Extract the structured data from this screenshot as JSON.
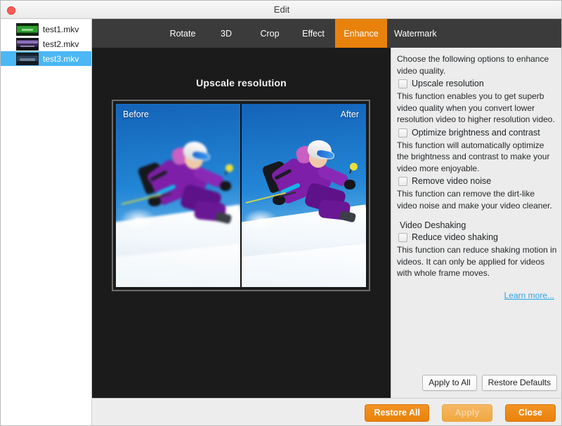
{
  "window": {
    "title": "Edit",
    "close_button": "close"
  },
  "sidebar": {
    "files": [
      {
        "name": "test1.mkv",
        "thumb": "thumb-green",
        "selected": false
      },
      {
        "name": "test2.mkv",
        "thumb": "thumb-purple",
        "selected": false
      },
      {
        "name": "test3.mkv",
        "thumb": "thumb-blue",
        "selected": true
      }
    ]
  },
  "tabs": {
    "items": [
      {
        "label": "Rotate",
        "active": false
      },
      {
        "label": "3D",
        "active": false
      },
      {
        "label": "Crop",
        "active": false
      },
      {
        "label": "Effect",
        "active": false
      },
      {
        "label": "Enhance",
        "active": true
      },
      {
        "label": "Watermark",
        "active": false
      }
    ],
    "active_color": "#e8820c",
    "bar_color": "#3b3b3b"
  },
  "preview": {
    "title": "Upscale resolution",
    "before_label": "Before",
    "after_label": "After",
    "background": "#1b1b1b"
  },
  "panel": {
    "intro": "Choose the following options to enhance video quality.",
    "options": [
      {
        "label": "Upscale resolution",
        "checked": false,
        "description": "This function enables you to get superb video quality when you convert lower resolution video to higher resolution video."
      },
      {
        "label": "Optimize brightness and contrast",
        "checked": false,
        "description": "This function will automatically optimize the brightness and contrast to make your video more enjoyable."
      },
      {
        "label": "Remove video noise",
        "checked": false,
        "description": "This function can remove the dirt-like video noise and make your video cleaner."
      }
    ],
    "deshake_section": {
      "heading": "Video Deshaking",
      "option": {
        "label": "Reduce video shaking",
        "checked": false,
        "description": "This function can reduce shaking motion in videos. It can only be applied for videos with whole frame moves."
      }
    },
    "learn_more": "Learn more...",
    "link_color": "#2aa3e8",
    "apply_to_all": "Apply to All",
    "restore_defaults": "Restore Defaults"
  },
  "footer": {
    "restore_all": "Restore All",
    "apply": "Apply",
    "apply_disabled": true,
    "close": "Close",
    "button_color": "#e9820b"
  }
}
